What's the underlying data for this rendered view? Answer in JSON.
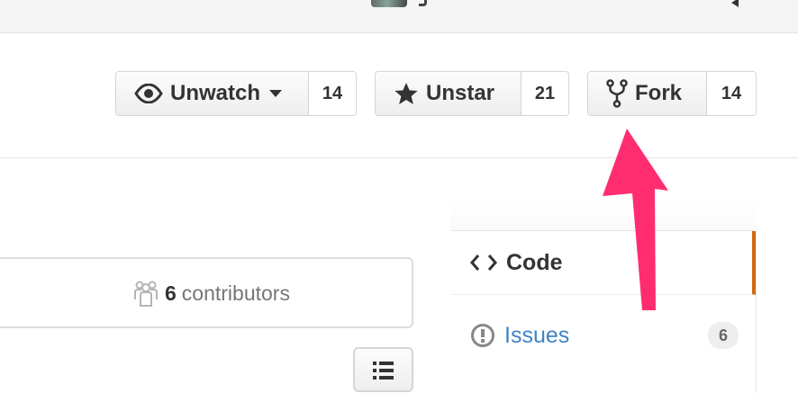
{
  "repo_actions": {
    "watch": {
      "label": "Unwatch",
      "count": "14",
      "icon": "eye-icon"
    },
    "star": {
      "label": "Unstar",
      "count": "21",
      "icon": "star-icon"
    },
    "fork": {
      "label": "Fork",
      "count": "14",
      "icon": "fork-icon"
    }
  },
  "summary": {
    "contributors_count": "6",
    "contributors_label": "contributors",
    "icon": "people-icon"
  },
  "sidebar": {
    "items": [
      {
        "label": "Code",
        "icon": "code-icon",
        "selected": true
      },
      {
        "label": "Issues",
        "icon": "issue-icon",
        "count": "6"
      }
    ]
  },
  "colors": {
    "annotation_arrow": "#ff2d6f",
    "selected_nav_accent": "#d26911",
    "link": "#4183c4"
  }
}
